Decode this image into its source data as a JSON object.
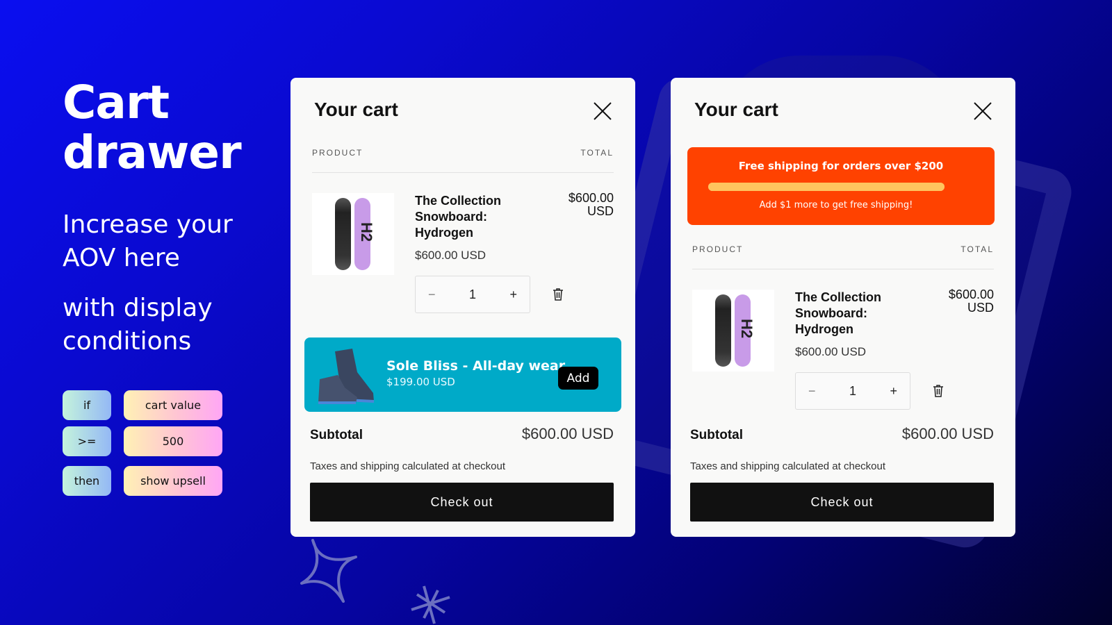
{
  "hero": {
    "title_line1": "Cart",
    "title_line2": "drawer",
    "subtitle_line1": "Increase your",
    "subtitle_line2": "AOV here",
    "subtitle2_line1": "with display",
    "subtitle2_line2": "conditions"
  },
  "conditions": [
    {
      "key": "if",
      "value": "cart value"
    },
    {
      "key": ">=",
      "value": "500"
    },
    {
      "key": "then",
      "value": "show upsell"
    }
  ],
  "cart_left": {
    "title": "Your cart",
    "col_product": "PRODUCT",
    "col_total": "TOTAL",
    "item": {
      "name": "The Collection Snowboard: Hydrogen",
      "price": "$600.00 USD",
      "total_line1": "$600.00",
      "total_line2": "USD",
      "quantity": "1",
      "thumb_label": "H2"
    },
    "upsell": {
      "name": "Sole Bliss - All-day wear",
      "price": "$199.00 USD",
      "add_label": "Add"
    },
    "subtotal_label": "Subtotal",
    "subtotal_value": "$600.00 USD",
    "taxes_note": "Taxes and shipping calculated at checkout",
    "checkout_label": "Check out"
  },
  "cart_right": {
    "title": "Your cart",
    "shipping": {
      "title": "Free shipping for orders over $200",
      "progress_fraction": 1.0,
      "note": "Add $1 more to get free shipping!"
    },
    "col_product": "PRODUCT",
    "col_total": "TOTAL",
    "item": {
      "name": "The Collection Snowboard: Hydrogen",
      "price": "$600.00 USD",
      "total_line1": "$600.00",
      "total_line2": "USD",
      "quantity": "1",
      "thumb_label": "H2"
    },
    "subtotal_label": "Subtotal",
    "subtotal_value": "$600.00 USD",
    "taxes_note": "Taxes and shipping calculated at checkout",
    "checkout_label": "Check out"
  },
  "qty_controls": {
    "minus": "−",
    "plus": "+"
  },
  "colors": {
    "upsell_bg": "#00aac8",
    "shipping_bg": "#ff4200",
    "shipping_bar": "#ffc45e",
    "checkout_bg": "#111111"
  }
}
